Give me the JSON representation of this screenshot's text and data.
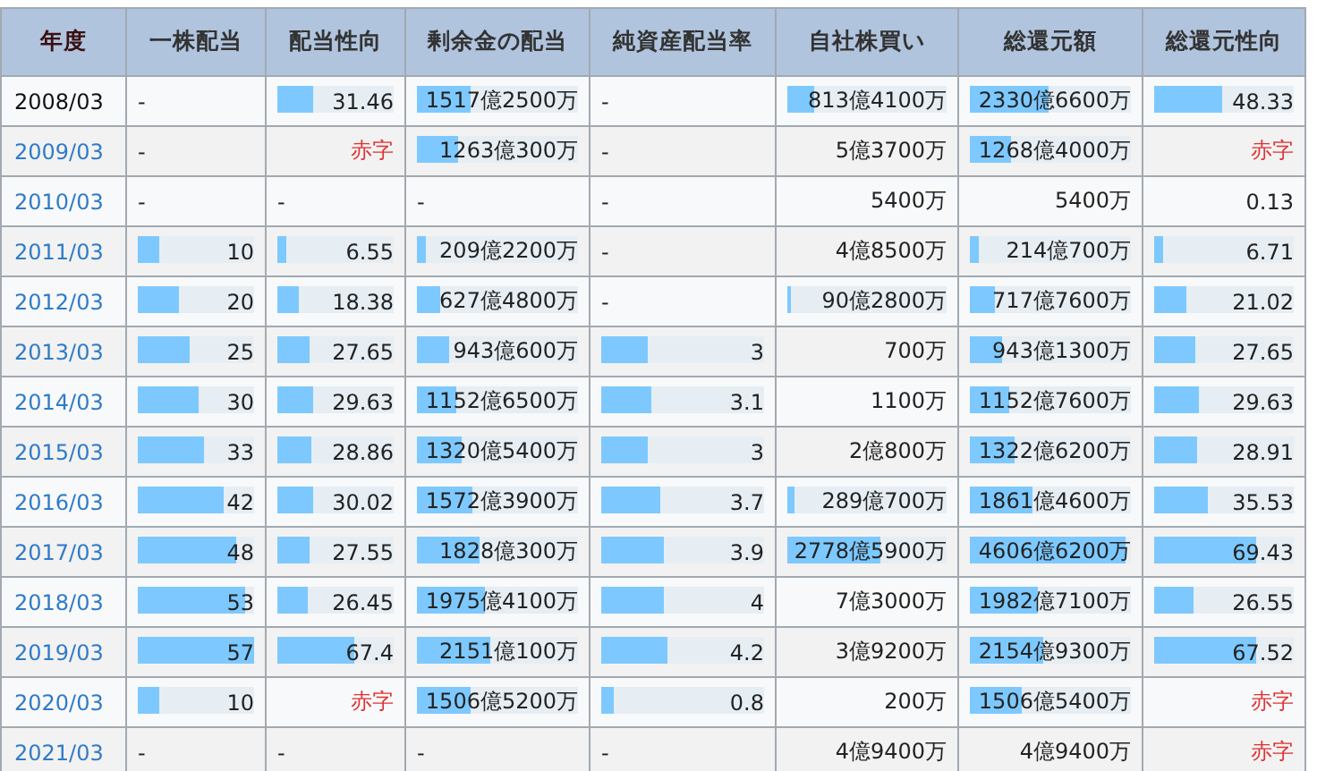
{
  "columns": [
    "年度",
    "一株配当",
    "配当性向",
    "剰余金の配当",
    "純資産配当率",
    "自社株買い",
    "総還元額",
    "総還元性向"
  ],
  "rows": [
    {
      "year": "2008/03",
      "link": false,
      "cells": [
        {
          "kind": "value",
          "text": "-"
        },
        {
          "kind": "value",
          "text": "31.46",
          "level": 0.31
        },
        {
          "kind": "value",
          "text": "1517億2500万",
          "level": 0.33
        },
        {
          "kind": "value",
          "text": "-"
        },
        {
          "kind": "value",
          "text": "813億4100万",
          "level": 0.17
        },
        {
          "kind": "value",
          "text": "2330億6600万",
          "level": 0.49
        },
        {
          "kind": "value",
          "text": "48.33",
          "level": 0.49
        }
      ]
    },
    {
      "year": "2009/03",
      "link": true,
      "cells": [
        {
          "kind": "value",
          "text": "-"
        },
        {
          "kind": "deficit",
          "text": "赤字"
        },
        {
          "kind": "value",
          "text": "1263億300万",
          "level": 0.26
        },
        {
          "kind": "value",
          "text": "-"
        },
        {
          "kind": "value",
          "text": "5億3700万"
        },
        {
          "kind": "value",
          "text": "1268億4000万",
          "level": 0.26
        },
        {
          "kind": "deficit",
          "text": "赤字"
        }
      ]
    },
    {
      "year": "2010/03",
      "link": true,
      "cells": [
        {
          "kind": "value",
          "text": "-"
        },
        {
          "kind": "value",
          "text": "-"
        },
        {
          "kind": "value",
          "text": "-"
        },
        {
          "kind": "value",
          "text": "-"
        },
        {
          "kind": "value",
          "text": "5400万"
        },
        {
          "kind": "value",
          "text": "5400万"
        },
        {
          "kind": "value",
          "text": "0.13"
        }
      ]
    },
    {
      "year": "2011/03",
      "link": true,
      "cells": [
        {
          "kind": "value",
          "text": "10",
          "level": 0.19
        },
        {
          "kind": "value",
          "text": "6.55",
          "level": 0.07
        },
        {
          "kind": "value",
          "text": "209億2200万",
          "level": 0.05
        },
        {
          "kind": "value",
          "text": "-"
        },
        {
          "kind": "value",
          "text": "4億8500万"
        },
        {
          "kind": "value",
          "text": "214億700万",
          "level": 0.05
        },
        {
          "kind": "value",
          "text": "6.71",
          "level": 0.07
        }
      ]
    },
    {
      "year": "2012/03",
      "link": true,
      "cells": [
        {
          "kind": "value",
          "text": "20",
          "level": 0.36
        },
        {
          "kind": "value",
          "text": "18.38",
          "level": 0.19
        },
        {
          "kind": "value",
          "text": "627億4800万",
          "level": 0.14
        },
        {
          "kind": "value",
          "text": "-"
        },
        {
          "kind": "value",
          "text": "90億2800万",
          "level": 0.02
        },
        {
          "kind": "value",
          "text": "717億7600万",
          "level": 0.15
        },
        {
          "kind": "value",
          "text": "21.02",
          "level": 0.23
        }
      ]
    },
    {
      "year": "2013/03",
      "link": true,
      "cells": [
        {
          "kind": "value",
          "text": "25",
          "level": 0.44
        },
        {
          "kind": "value",
          "text": "27.65",
          "level": 0.27
        },
        {
          "kind": "value",
          "text": "943億600万",
          "level": 0.2
        },
        {
          "kind": "value",
          "text": "3",
          "level": 0.29
        },
        {
          "kind": "value",
          "text": "700万"
        },
        {
          "kind": "value",
          "text": "943億1300万",
          "level": 0.2
        },
        {
          "kind": "value",
          "text": "27.65",
          "level": 0.29
        }
      ]
    },
    {
      "year": "2014/03",
      "link": true,
      "cells": [
        {
          "kind": "value",
          "text": "30",
          "level": 0.53
        },
        {
          "kind": "value",
          "text": "29.63",
          "level": 0.3
        },
        {
          "kind": "value",
          "text": "1152億6500万",
          "level": 0.24
        },
        {
          "kind": "value",
          "text": "3.1",
          "level": 0.31
        },
        {
          "kind": "value",
          "text": "1100万"
        },
        {
          "kind": "value",
          "text": "1152億7600万",
          "level": 0.24
        },
        {
          "kind": "value",
          "text": "29.63",
          "level": 0.32
        }
      ]
    },
    {
      "year": "2015/03",
      "link": true,
      "cells": [
        {
          "kind": "value",
          "text": "33",
          "level": 0.57
        },
        {
          "kind": "value",
          "text": "28.86",
          "level": 0.29
        },
        {
          "kind": "value",
          "text": "1320億5400万",
          "level": 0.28
        },
        {
          "kind": "value",
          "text": "3",
          "level": 0.29
        },
        {
          "kind": "value",
          "text": "2億800万"
        },
        {
          "kind": "value",
          "text": "1322億6200万",
          "level": 0.28
        },
        {
          "kind": "value",
          "text": "28.91",
          "level": 0.31
        }
      ]
    },
    {
      "year": "2016/03",
      "link": true,
      "cells": [
        {
          "kind": "value",
          "text": "42",
          "level": 0.74
        },
        {
          "kind": "value",
          "text": "30.02",
          "level": 0.3
        },
        {
          "kind": "value",
          "text": "1572億3900万",
          "level": 0.34
        },
        {
          "kind": "value",
          "text": "3.7",
          "level": 0.36
        },
        {
          "kind": "value",
          "text": "289億700万",
          "level": 0.05
        },
        {
          "kind": "value",
          "text": "1861億4600万",
          "level": 0.39
        },
        {
          "kind": "value",
          "text": "35.53",
          "level": 0.39
        }
      ]
    },
    {
      "year": "2017/03",
      "link": true,
      "cells": [
        {
          "kind": "value",
          "text": "48",
          "level": 0.84
        },
        {
          "kind": "value",
          "text": "27.55",
          "level": 0.27
        },
        {
          "kind": "value",
          "text": "1828億300万",
          "level": 0.39
        },
        {
          "kind": "value",
          "text": "3.9",
          "level": 0.38
        },
        {
          "kind": "value",
          "text": "2778億5900万",
          "level": 0.58
        },
        {
          "kind": "value",
          "text": "4606億6200万",
          "level": 0.97
        },
        {
          "kind": "value",
          "text": "69.43",
          "level": 0.73
        }
      ]
    },
    {
      "year": "2018/03",
      "link": true,
      "cells": [
        {
          "kind": "value",
          "text": "53",
          "level": 0.93
        },
        {
          "kind": "value",
          "text": "26.45",
          "level": 0.26
        },
        {
          "kind": "value",
          "text": "1975億4100万",
          "level": 0.42
        },
        {
          "kind": "value",
          "text": "4",
          "level": 0.39
        },
        {
          "kind": "value",
          "text": "7億3000万"
        },
        {
          "kind": "value",
          "text": "1982億7100万",
          "level": 0.42
        },
        {
          "kind": "value",
          "text": "26.55",
          "level": 0.28
        }
      ]
    },
    {
      "year": "2019/03",
      "link": true,
      "cells": [
        {
          "kind": "value",
          "text": "57",
          "level": 1.0
        },
        {
          "kind": "value",
          "text": "67.4",
          "level": 0.66
        },
        {
          "kind": "value",
          "text": "2151億100万",
          "level": 0.45
        },
        {
          "kind": "value",
          "text": "4.2",
          "level": 0.41
        },
        {
          "kind": "value",
          "text": "3億9200万"
        },
        {
          "kind": "value",
          "text": "2154億9300万",
          "level": 0.45
        },
        {
          "kind": "value",
          "text": "67.52",
          "level": 0.73
        }
      ]
    },
    {
      "year": "2020/03",
      "link": true,
      "cells": [
        {
          "kind": "value",
          "text": "10",
          "level": 0.19
        },
        {
          "kind": "deficit",
          "text": "赤字"
        },
        {
          "kind": "value",
          "text": "1506億5200万",
          "level": 0.33
        },
        {
          "kind": "value",
          "text": "0.8",
          "level": 0.08
        },
        {
          "kind": "value",
          "text": "200万"
        },
        {
          "kind": "value",
          "text": "1506億5400万",
          "level": 0.32
        },
        {
          "kind": "deficit",
          "text": "赤字"
        }
      ]
    },
    {
      "year": "2021/03",
      "link": true,
      "cells": [
        {
          "kind": "value",
          "text": "-"
        },
        {
          "kind": "value",
          "text": "-"
        },
        {
          "kind": "value",
          "text": "-"
        },
        {
          "kind": "value",
          "text": "-"
        },
        {
          "kind": "value",
          "text": "4億9400万"
        },
        {
          "kind": "value",
          "text": "4億9400万"
        },
        {
          "kind": "deficit",
          "text": "赤字"
        }
      ]
    }
  ]
}
